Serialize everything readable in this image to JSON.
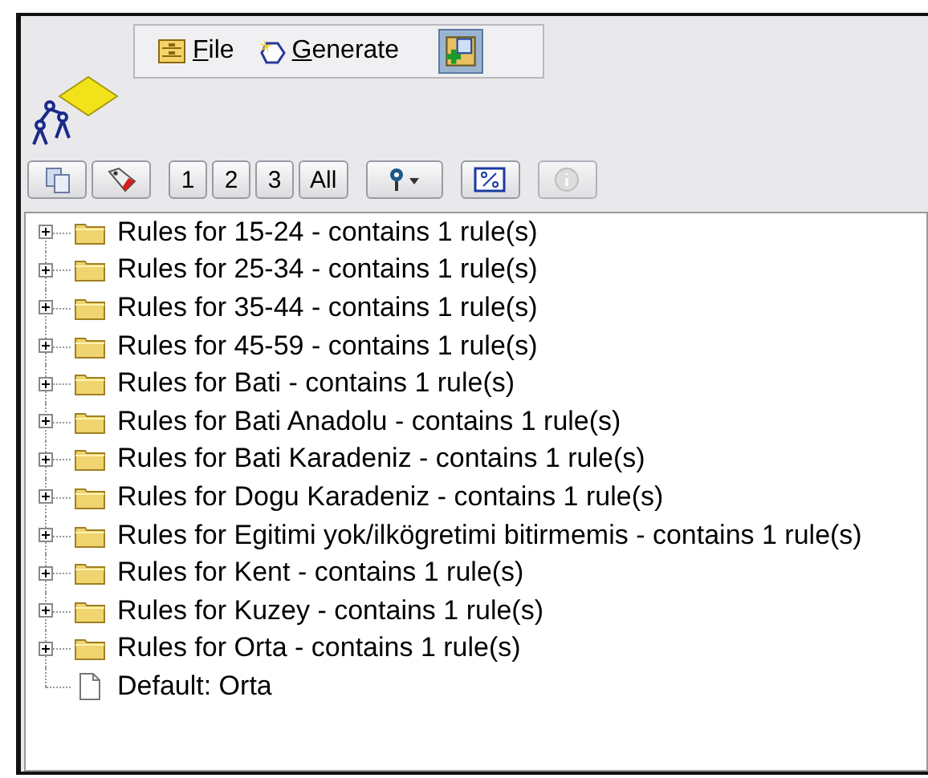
{
  "menu": [
    {
      "mnemonic": "F",
      "rest": "ile",
      "kind": "file"
    },
    {
      "mnemonic": "G",
      "rest": "enerate",
      "kind": "generate"
    }
  ],
  "toolbar": {
    "level_buttons": [
      "1",
      "2",
      "3",
      "All"
    ],
    "info_disabled": true
  },
  "tree": [
    {
      "kind": "folder",
      "label": "Rules for 15-24 - contains 1 rule(s)",
      "expanded": false
    },
    {
      "kind": "folder",
      "label": "Rules for 25-34 - contains 1 rule(s)",
      "expanded": false
    },
    {
      "kind": "folder",
      "label": "Rules for 35-44 - contains 1 rule(s)",
      "expanded": false
    },
    {
      "kind": "folder",
      "label": "Rules for 45-59 - contains 1 rule(s)",
      "expanded": false
    },
    {
      "kind": "folder",
      "label": "Rules for Bati - contains 1 rule(s)",
      "expanded": false
    },
    {
      "kind": "folder",
      "label": "Rules for Bati Anadolu - contains 1 rule(s)",
      "expanded": false
    },
    {
      "kind": "folder",
      "label": "Rules for Bati Karadeniz - contains 1 rule(s)",
      "expanded": false
    },
    {
      "kind": "folder",
      "label": "Rules for Dogu Karadeniz - contains 1 rule(s)",
      "expanded": false
    },
    {
      "kind": "folder",
      "label": "Rules for Egitimi yok/ilkögretimi bitirmemis - contains 1 rule(s)",
      "expanded": false
    },
    {
      "kind": "folder",
      "label": "Rules for Kent - contains 1 rule(s)",
      "expanded": false
    },
    {
      "kind": "folder",
      "label": "Rules for Kuzey - contains 1 rule(s)",
      "expanded": false
    },
    {
      "kind": "folder",
      "label": "Rules for Orta - contains 1 rule(s)",
      "expanded": false
    },
    {
      "kind": "document",
      "label": "Default: Orta"
    }
  ]
}
